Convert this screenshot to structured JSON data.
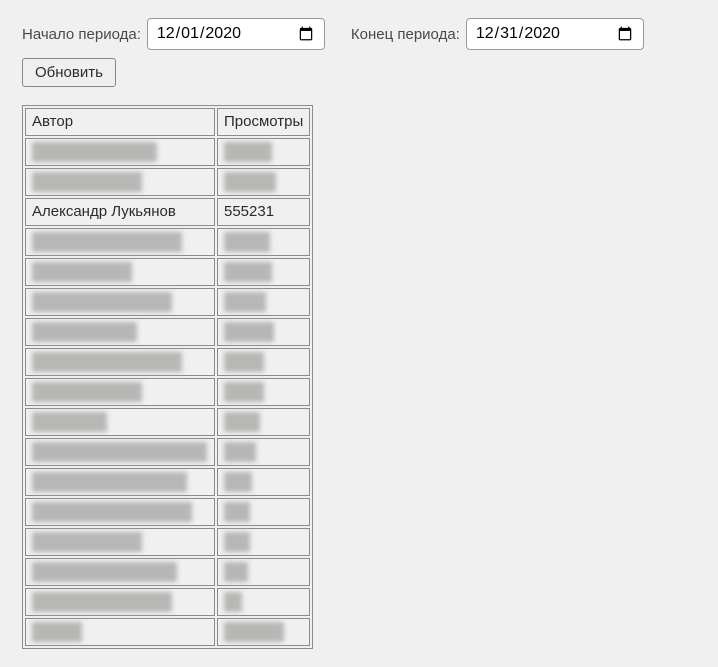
{
  "controls": {
    "start_label": "Начало периода:",
    "start_value": "2020-12-01",
    "end_label": "Конец периода:",
    "end_value": "2020-12-31",
    "update_label": "Обновить"
  },
  "table": {
    "headers": {
      "author": "Автор",
      "views": "Просмотры"
    },
    "rows": [
      {
        "author": "",
        "views": "",
        "blurred": true,
        "aw": 125,
        "vw": 48
      },
      {
        "author": "",
        "views": "",
        "blurred": true,
        "aw": 110,
        "vw": 52
      },
      {
        "author": "Александр Лукьянов",
        "views": "555231",
        "blurred": false
      },
      {
        "author": "",
        "views": "",
        "blurred": true,
        "aw": 150,
        "vw": 46
      },
      {
        "author": "",
        "views": "",
        "blurred": true,
        "aw": 100,
        "vw": 48
      },
      {
        "author": "",
        "views": "",
        "blurred": true,
        "aw": 140,
        "vw": 42
      },
      {
        "author": "",
        "views": "",
        "blurred": true,
        "aw": 105,
        "vw": 50
      },
      {
        "author": "",
        "views": "",
        "blurred": true,
        "aw": 150,
        "vw": 40
      },
      {
        "author": "",
        "views": "",
        "blurred": true,
        "aw": 110,
        "vw": 40
      },
      {
        "author": "",
        "views": "",
        "blurred": true,
        "aw": 75,
        "vw": 36
      },
      {
        "author": "",
        "views": "",
        "blurred": true,
        "aw": 175,
        "vw": 32
      },
      {
        "author": "",
        "views": "",
        "blurred": true,
        "aw": 155,
        "vw": 28
      },
      {
        "author": "",
        "views": "",
        "blurred": true,
        "aw": 160,
        "vw": 26
      },
      {
        "author": "",
        "views": "",
        "blurred": true,
        "aw": 110,
        "vw": 26
      },
      {
        "author": "",
        "views": "",
        "blurred": true,
        "aw": 145,
        "vw": 24
      },
      {
        "author": "",
        "views": "",
        "blurred": true,
        "aw": 140,
        "vw": 18
      },
      {
        "author": "",
        "views": "",
        "blurred": true,
        "aw": 50,
        "vw": 60
      }
    ]
  }
}
